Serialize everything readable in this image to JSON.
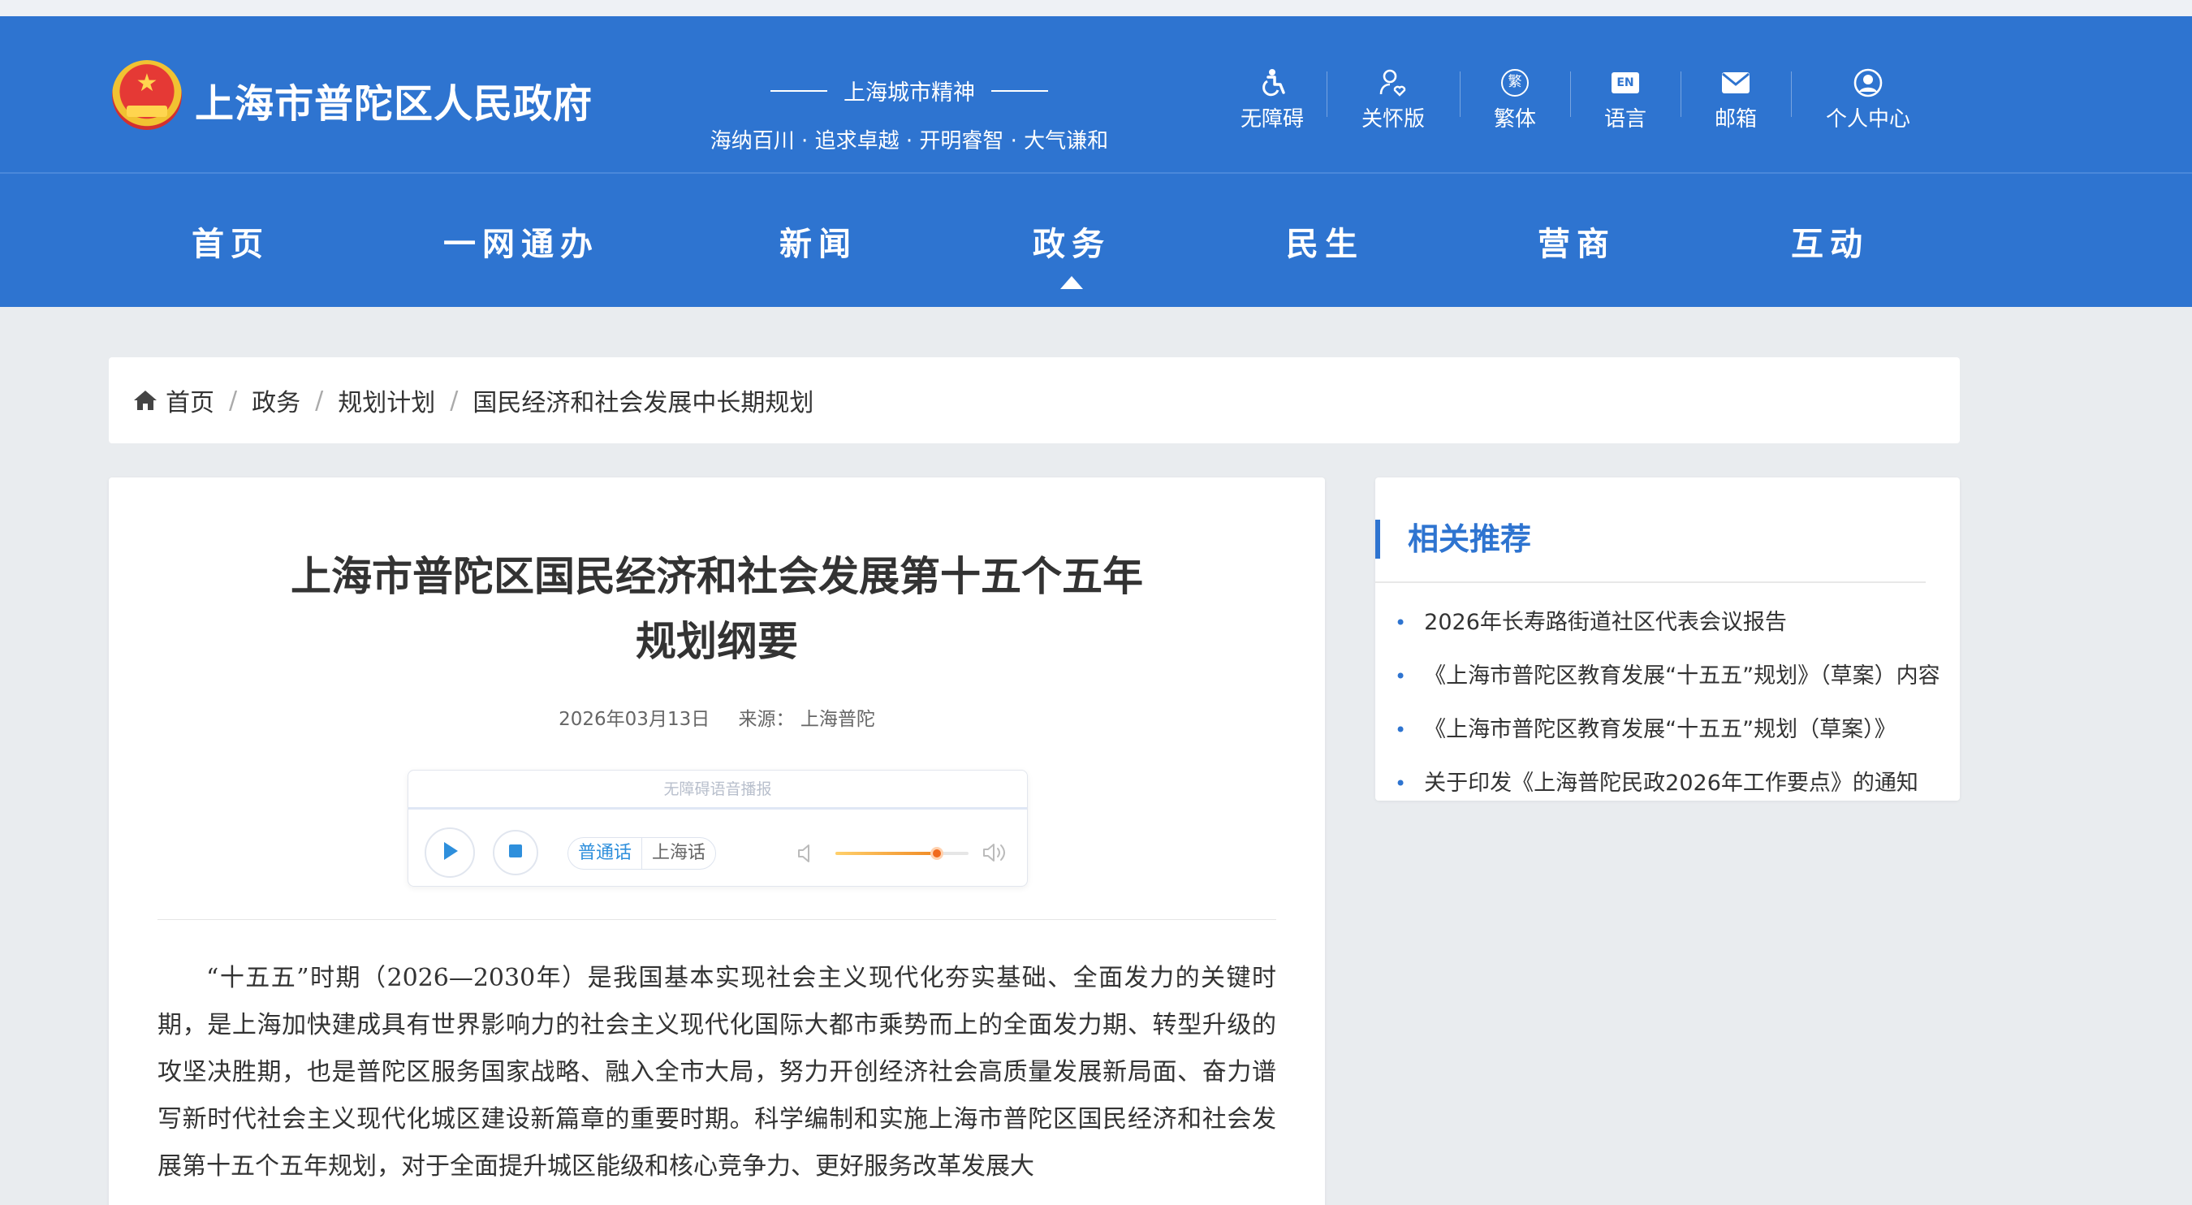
{
  "site": {
    "title": "上海市普陀区人民政府",
    "motto_title": "上海城市精神",
    "motto_sub": "海纳百川 · 追求卓越 · 开明睿智 · 大气谦和"
  },
  "tools": [
    {
      "label": "无障碍",
      "icon": "accessibility-icon"
    },
    {
      "label": "关怀版",
      "icon": "care-mode-icon"
    },
    {
      "label": "繁体",
      "icon": "traditional-chinese-icon",
      "glyph": "繁"
    },
    {
      "label": "语言",
      "icon": "language-icon",
      "glyph": "EN"
    },
    {
      "label": "邮箱",
      "icon": "mail-icon"
    },
    {
      "label": "个人中心",
      "icon": "user-icon"
    }
  ],
  "nav": {
    "items": [
      "首页",
      "一网通办",
      "新闻",
      "政务",
      "民生",
      "营商",
      "互动"
    ],
    "active": "政务"
  },
  "breadcrumb": [
    "首页",
    "政务",
    "规划计划",
    "国民经济和社会发展中长期规划"
  ],
  "article": {
    "title_line1": "上海市普陀区国民经济和社会发展第十五个五年",
    "title_line2": "规划纲要",
    "date": "2026年03月13日",
    "source": "来源：  上海普陀",
    "body": "“十五五”时期（2026—2030年）是我国基本实现社会主义现代化夯实基础、全面发力的关键时期，是上海加快建成具有世界影响力的社会主义现代化国际大都市乘势而上的全面发力期、转型升级的攻坚决胜期，也是普陀区服务国家战略、融入全市大局，努力开创经济社会高质量发展新局面、奋力谱写新时代社会主义现代化城区建设新篇章的重要时期。科学编制和实施上海市普陀区国民经济和社会发展第十五个五年规划，对于全面提升城区能级和核心竞争力、更好服务改革发展大"
  },
  "player": {
    "title": "无障碍语音播报",
    "lang_options": [
      "普通话",
      "上海话"
    ],
    "selected_lang": "普通话",
    "volume_fraction": 0.76
  },
  "related": {
    "title": "相关推荐",
    "items": [
      "2026年长寿路街道社区代表会议报告",
      "《上海市普陀区教育发展“十五五”规划》（草案）内容",
      "《上海市普陀区教育发展“十五五”规划（草案）》",
      "关于印发《上海普陀民政2026年工作要点》的通知"
    ]
  },
  "colors": {
    "brand_blue": "#2e74d0",
    "page_bg": "#e9ecef",
    "volume_orange": "#f06a1e"
  }
}
